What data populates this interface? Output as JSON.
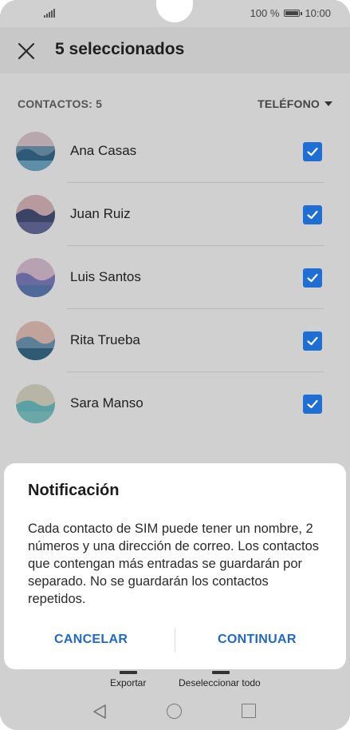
{
  "status_bar": {
    "battery": "100 %",
    "time": "10:00"
  },
  "app_bar": {
    "title": "5 seleccionados",
    "close_icon": "close-icon"
  },
  "section": {
    "count_label": "CONTACTOS: 5",
    "source_label": "TELÉFONO"
  },
  "contacts": [
    {
      "name": "Ana Casas",
      "checked": true
    },
    {
      "name": "Juan Ruiz",
      "checked": true
    },
    {
      "name": "Luis Santos",
      "checked": true
    },
    {
      "name": "Rita Trueba",
      "checked": true
    },
    {
      "name": "Sara Manso",
      "checked": true
    }
  ],
  "bottom_bar": {
    "export_label": "Exportar",
    "deselect_label": "Deseleccionar todo"
  },
  "dialog": {
    "title": "Notificación",
    "body": "Cada contacto de SIM puede tener un nombre, 2 números y una dirección de correo. Los contactos que contengan más entradas se guardarán por separado. No se guardarán los contactos repetidos.",
    "cancel_label": "CANCELAR",
    "continue_label": "CONTINUAR"
  },
  "colors": {
    "accent": "#2268c8",
    "checkbox": "#1f6ed3",
    "scrim": "#d0d0d0"
  }
}
